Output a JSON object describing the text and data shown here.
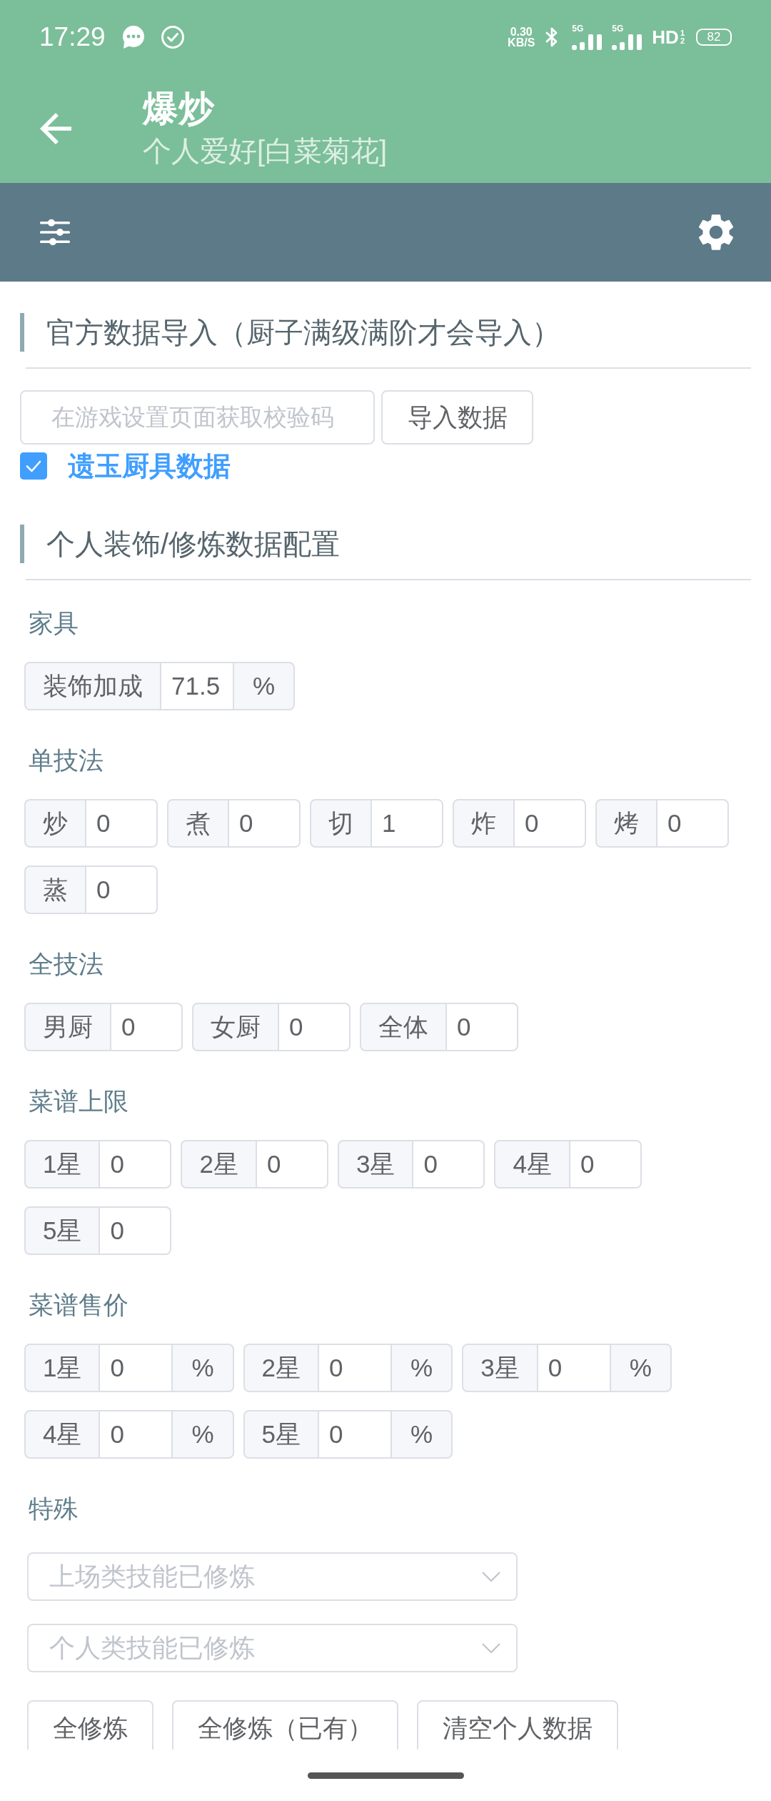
{
  "status_bar": {
    "time": "17:29",
    "net_speed": "0.30",
    "net_speed_unit": "KB/S",
    "signal_labels": [
      "5G",
      "5G"
    ],
    "hd": "HD",
    "hd_slots": [
      "1",
      "2"
    ],
    "battery": "82"
  },
  "header": {
    "title": "爆炒",
    "subtitle": "个人爱好[白菜菊花]"
  },
  "import_section": {
    "title": "官方数据导入（厨子满级满阶才会导入）",
    "code_field": {
      "placeholder": "在游戏设置页面获取校验码"
    },
    "import_button": "导入数据",
    "jade_option": {
      "label": "遗玉厨具数据",
      "checked": true
    }
  },
  "config_section": {
    "title": "个人装饰/修炼数据配置",
    "groups": [
      {
        "label": "家具",
        "fields": [
          {
            "prepend": "装饰加成",
            "value": "71.5",
            "append": "%"
          }
        ]
      },
      {
        "label": "单技法",
        "fields": [
          {
            "prepend": "炒",
            "value": "0"
          },
          {
            "prepend": "煮",
            "value": "0"
          },
          {
            "prepend": "切",
            "value": "1"
          },
          {
            "prepend": "炸",
            "value": "0"
          },
          {
            "prepend": "烤",
            "value": "0"
          },
          {
            "prepend": "蒸",
            "value": "0"
          }
        ]
      },
      {
        "label": "全技法",
        "fields": [
          {
            "prepend": "男厨",
            "value": "0"
          },
          {
            "prepend": "女厨",
            "value": "0"
          },
          {
            "prepend": "全体",
            "value": "0"
          }
        ]
      },
      {
        "label": "菜谱上限",
        "fields": [
          {
            "prepend": "1星",
            "value": "0"
          },
          {
            "prepend": "2星",
            "value": "0"
          },
          {
            "prepend": "3星",
            "value": "0"
          },
          {
            "prepend": "4星",
            "value": "0"
          },
          {
            "prepend": "5星",
            "value": "0"
          }
        ]
      },
      {
        "label": "菜谱售价",
        "fields": [
          {
            "prepend": "1星",
            "value": "0",
            "append": "%"
          },
          {
            "prepend": "2星",
            "value": "0",
            "append": "%"
          },
          {
            "prepend": "3星",
            "value": "0",
            "append": "%"
          },
          {
            "prepend": "4星",
            "value": "0",
            "append": "%"
          },
          {
            "prepend": "5星",
            "value": "0",
            "append": "%"
          }
        ]
      }
    ],
    "special": {
      "label": "特殊",
      "selects": [
        {
          "placeholder": "上场类技能已修炼"
        },
        {
          "placeholder": "个人类技能已修炼"
        }
      ]
    },
    "buttons": [
      "全修炼",
      "全修炼（已有）",
      "清空个人数据"
    ]
  }
}
